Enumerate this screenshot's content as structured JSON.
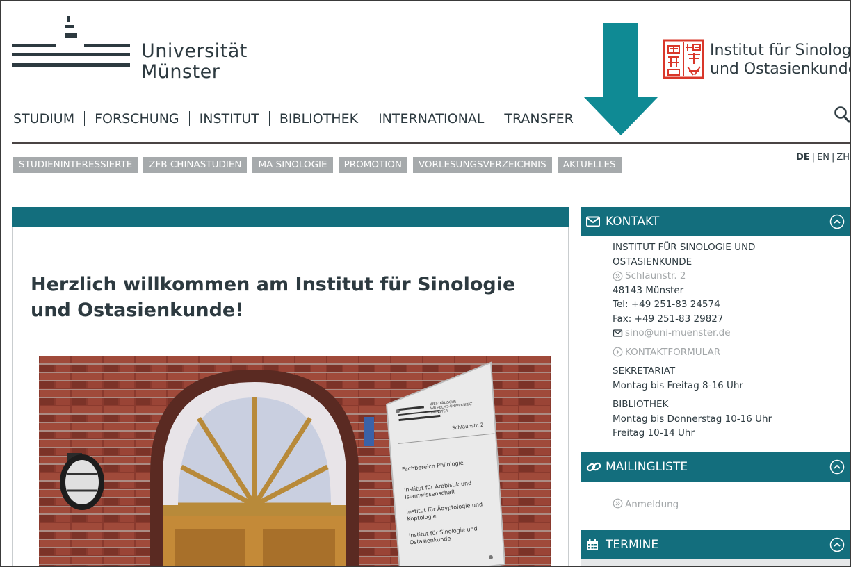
{
  "header": {
    "uni_name_line1": "Universität",
    "uni_name_line2": "Münster",
    "institute_name_line1": "Institut für Sinologie",
    "institute_name_line2": "und Ostasienkunde"
  },
  "main_nav": {
    "items": [
      "STUDIUM",
      "FORSCHUNG",
      "INSTITUT",
      "BIBLIOTHEK",
      "INTERNATIONAL",
      "TRANSFER"
    ]
  },
  "sub_nav": {
    "items": [
      "STUDIENINTERESSIERTE",
      "ZFB CHINASTUDIEN",
      "MA SINOLOGIE",
      "PROMOTION",
      "VORLESUNGSVERZEICHNIS",
      "AKTUELLES"
    ]
  },
  "languages": {
    "de": "DE",
    "en": "EN",
    "zh": "ZH",
    "active": "DE"
  },
  "main": {
    "headline": "Herzlich willkommen am Institut für Sinologie und Ostasienkunde!",
    "photo_sign": {
      "logo_text": "WESTFÄLISCHE WILHELMS-UNIVERSITÄT MÜNSTER",
      "address": "Schlaunstr. 2",
      "lines": [
        "Fachbereich Philologie",
        "Institut für Arabistik und Islamwissenschaft",
        "Institut für Ägyptologie und Koptologie",
        "Institut für Sinologie und Ostasienkunde"
      ]
    }
  },
  "sidebar": {
    "kontakt": {
      "title": "KONTAKT",
      "institute_line1": "INSTITUT FÜR SINOLOGIE UND",
      "institute_line2": "OSTASIENKUNDE",
      "street": "Schlaunstr. 2",
      "city": "48143 Münster",
      "tel": "Tel: +49 251-83 24574",
      "fax": "Fax: +49 251-83 29827",
      "email": "sino@uni-muenster.de",
      "form_link": "KONTAKTFORMULAR",
      "secretariat_label": "SEKRETARIAT",
      "secretariat_hours": "Montag bis Freitag 8-16 Uhr",
      "library_label": "BIBLIOTHEK",
      "library_hours_1": "Montag bis Donnerstag 10-16 Uhr",
      "library_hours_2": "Freitag 10-14 Uhr"
    },
    "mailingliste": {
      "title": "MAILINGLISTE",
      "link": "Anmeldung"
    },
    "termine": {
      "title": "TERMINE"
    }
  },
  "colors": {
    "teal": "#136e7d",
    "arrow": "#0f8a94",
    "chip": "#a6aaac",
    "text": "#2d3a40",
    "muted": "#a3a7a9",
    "seal_red": "#d9372a"
  },
  "icons": [
    "search-icon",
    "envelope-icon",
    "link-icon",
    "calendar-icon",
    "chevron-up-circle-icon",
    "double-chevron-circle-icon",
    "chevron-circle-icon",
    "arrow-down-icon"
  ]
}
